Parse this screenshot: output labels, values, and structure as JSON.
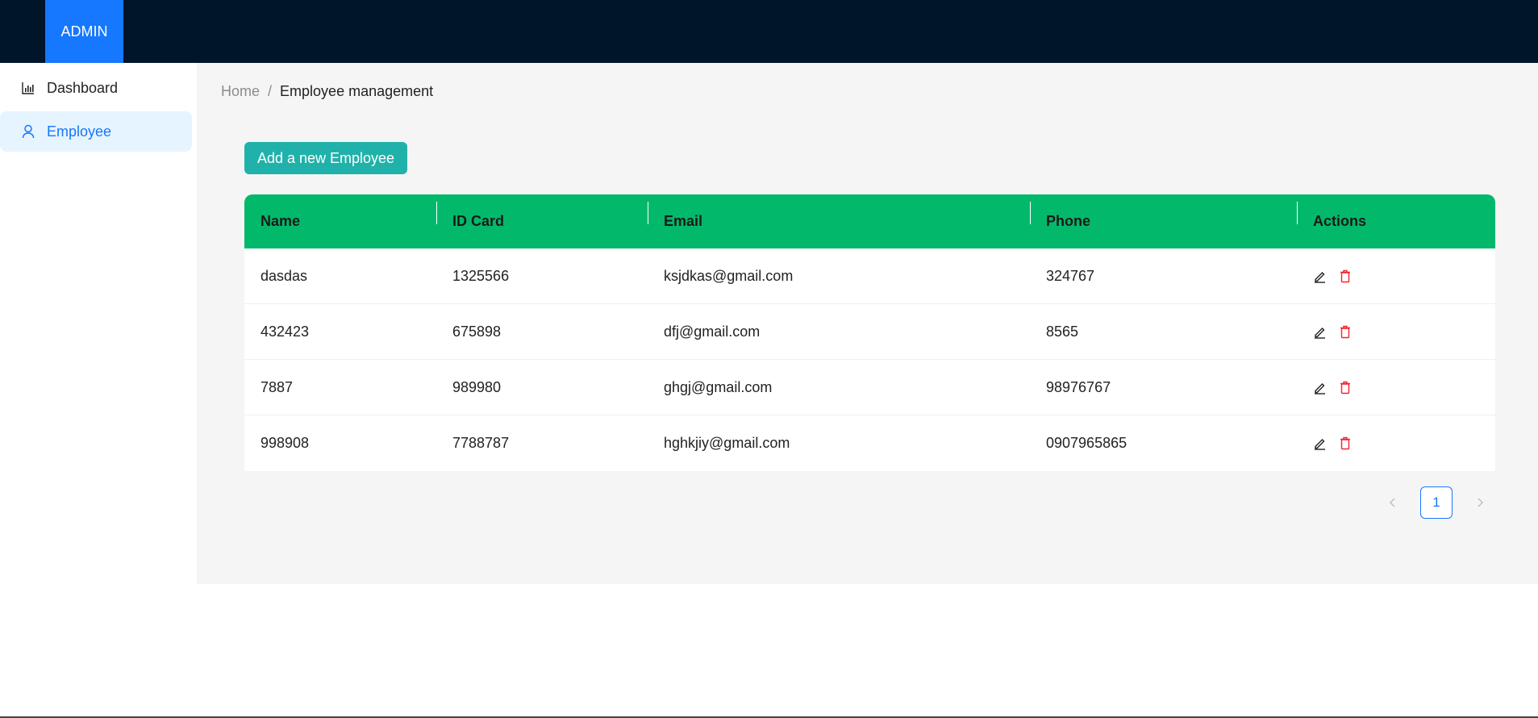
{
  "header": {
    "brand": "ADMIN"
  },
  "sidebar": {
    "items": [
      {
        "label": "Dashboard",
        "icon": "bar-chart-icon",
        "active": false
      },
      {
        "label": "Employee",
        "icon": "user-icon",
        "active": true
      }
    ]
  },
  "breadcrumb": {
    "home": "Home",
    "separator": "/",
    "current": "Employee management"
  },
  "toolbar": {
    "add_label": "Add a new Employee"
  },
  "table": {
    "columns": [
      "Name",
      "ID Card",
      "Email",
      "Phone",
      "Actions"
    ],
    "rows": [
      {
        "name": "dasdas",
        "id_card": "1325566",
        "email": "ksjdkas@gmail.com",
        "phone": "324767"
      },
      {
        "name": "432423",
        "id_card": "675898",
        "email": "dfj@gmail.com",
        "phone": "8565"
      },
      {
        "name": "7887",
        "id_card": "989980",
        "email": "ghgj@gmail.com",
        "phone": "98976767"
      },
      {
        "name": "998908",
        "id_card": "7788787",
        "email": "hghkjiy@gmail.com",
        "phone": "0907965865"
      }
    ]
  },
  "pagination": {
    "current_page": "1"
  },
  "colors": {
    "header_bg": "#001529",
    "brand_bg": "#1677ff",
    "table_header": "#02b96b",
    "add_button": "#20b2aa",
    "delete": "#f5222d"
  }
}
